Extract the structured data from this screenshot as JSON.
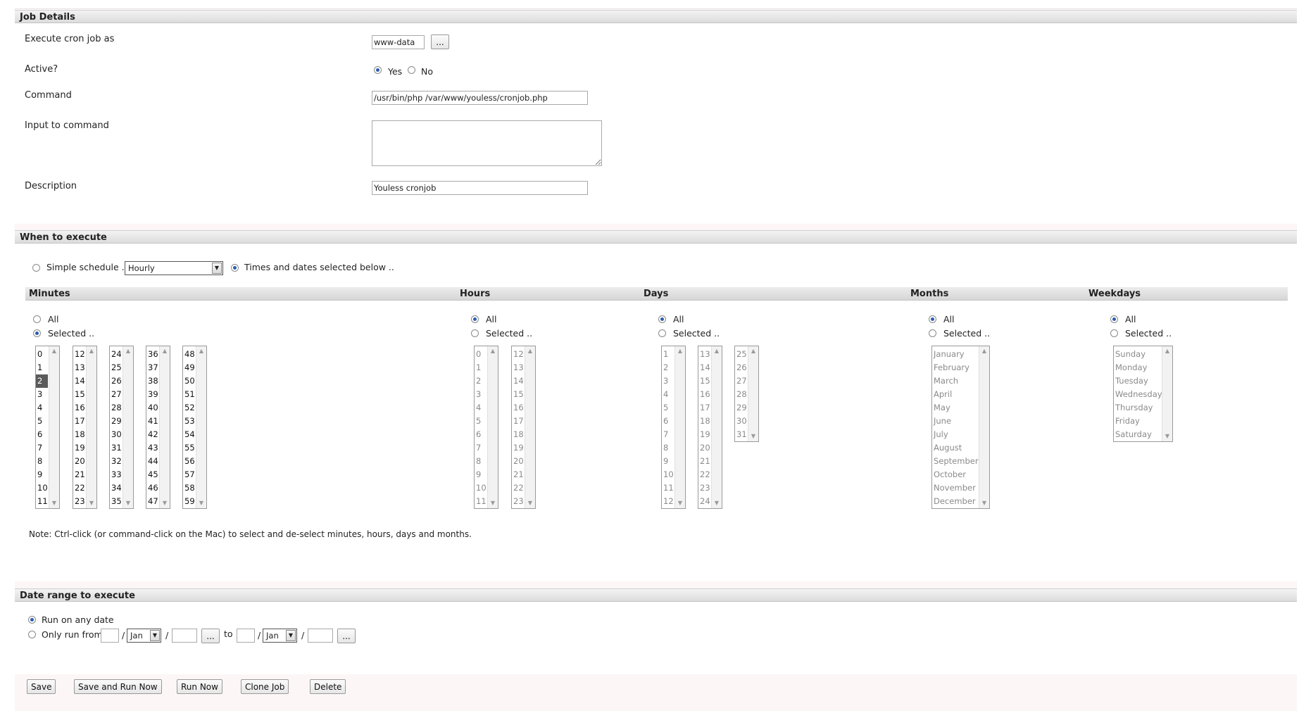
{
  "job_details": {
    "header": "Job Details",
    "execute_as_label": "Execute cron job as",
    "execute_as_value": "www-data",
    "browse_label": "...",
    "active_label": "Active?",
    "active_yes": "Yes",
    "active_no": "No",
    "active_selected": "Yes",
    "command_label": "Command",
    "command_value": "/usr/bin/php /var/www/youless/cronjob.php",
    "input_label": "Input to command",
    "input_value": "",
    "description_label": "Description",
    "description_value": "Youless cronjob"
  },
  "when": {
    "header": "When to execute",
    "simple_label": "Simple schedule ..",
    "simple_value": "Hourly",
    "times_label": "Times and dates selected below ..",
    "mode_selected": "times"
  },
  "columns": {
    "minutes": {
      "title": "Minutes",
      "all": "All",
      "selected": "Selected ..",
      "choice": "selected",
      "lists": [
        [
          "0",
          "1",
          "2",
          "3",
          "4",
          "5",
          "6",
          "7",
          "8",
          "9",
          "10",
          "11"
        ],
        [
          "12",
          "13",
          "14",
          "15",
          "16",
          "17",
          "18",
          "19",
          "20",
          "21",
          "22",
          "23"
        ],
        [
          "24",
          "25",
          "26",
          "27",
          "28",
          "29",
          "30",
          "31",
          "32",
          "33",
          "34",
          "35"
        ],
        [
          "36",
          "37",
          "38",
          "39",
          "40",
          "41",
          "42",
          "43",
          "44",
          "45",
          "46",
          "47"
        ],
        [
          "48",
          "49",
          "50",
          "51",
          "52",
          "53",
          "54",
          "55",
          "56",
          "57",
          "58",
          "59"
        ]
      ],
      "selected_values": [
        "2"
      ]
    },
    "hours": {
      "title": "Hours",
      "all": "All",
      "selected": "Selected ..",
      "choice": "all",
      "lists": [
        [
          "0",
          "1",
          "2",
          "3",
          "4",
          "5",
          "6",
          "7",
          "8",
          "9",
          "10",
          "11"
        ],
        [
          "12",
          "13",
          "14",
          "15",
          "16",
          "17",
          "18",
          "19",
          "20",
          "21",
          "22",
          "23"
        ]
      ]
    },
    "days": {
      "title": "Days",
      "all": "All",
      "selected": "Selected ..",
      "choice": "all",
      "lists": [
        [
          "1",
          "2",
          "3",
          "4",
          "5",
          "6",
          "7",
          "8",
          "9",
          "10",
          "11",
          "12"
        ],
        [
          "13",
          "14",
          "15",
          "16",
          "17",
          "18",
          "19",
          "20",
          "21",
          "22",
          "23",
          "24"
        ],
        [
          "25",
          "26",
          "27",
          "28",
          "29",
          "30",
          "31"
        ]
      ]
    },
    "months": {
      "title": "Months",
      "all": "All",
      "selected": "Selected ..",
      "choice": "all",
      "lists": [
        [
          "January",
          "February",
          "March",
          "April",
          "May",
          "June",
          "July",
          "August",
          "September",
          "October",
          "November",
          "December"
        ]
      ]
    },
    "weekdays": {
      "title": "Weekdays",
      "all": "All",
      "selected": "Selected ..",
      "choice": "all",
      "lists": [
        [
          "Sunday",
          "Monday",
          "Tuesday",
          "Wednesday",
          "Thursday",
          "Friday",
          "Saturday"
        ]
      ]
    }
  },
  "note": "Note: Ctrl-click (or command-click on the Mac) to select and de-select minutes, hours, days and months.",
  "date_range": {
    "header": "Date range to execute",
    "any_label": "Run on any date",
    "only_label": "Only run from",
    "selected": "any",
    "from_day": "",
    "from_month": "Jan",
    "from_year": "",
    "to_label": "to",
    "to_day": "",
    "to_month": "Jan",
    "to_year": "",
    "slash": "/",
    "browse_label": "..."
  },
  "actions": {
    "save": "Save",
    "save_run": "Save and Run Now",
    "run_now": "Run Now",
    "clone": "Clone Job",
    "delete": "Delete"
  }
}
